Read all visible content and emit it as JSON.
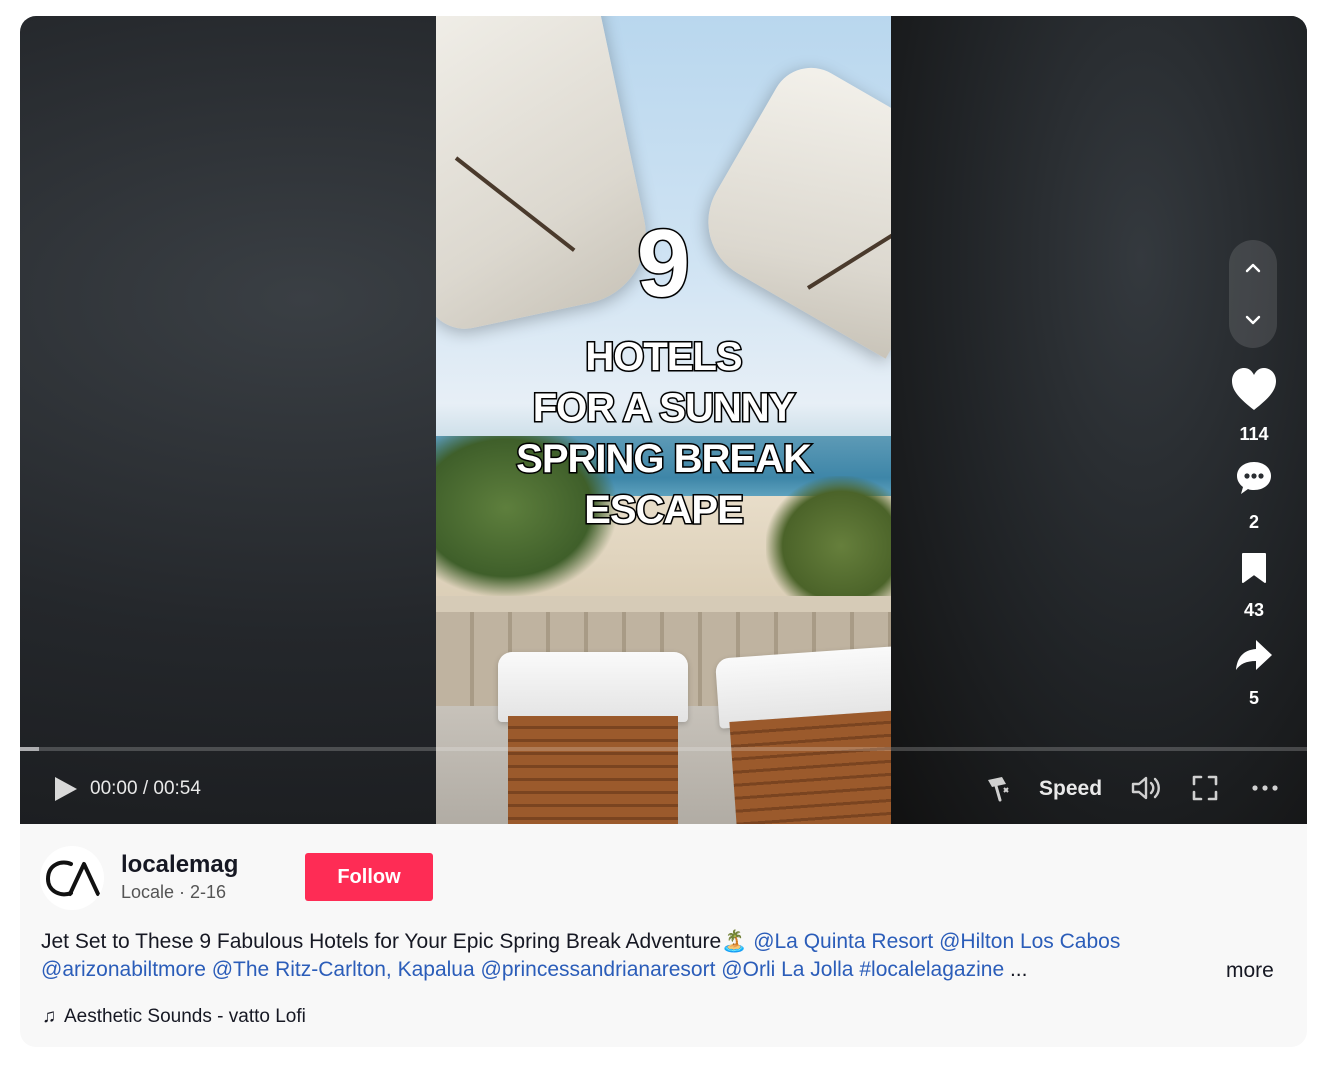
{
  "video": {
    "overlay_number": "9",
    "overlay_lines": [
      "HOTELS",
      "FOR A SUNNY",
      "SPRING BREAK",
      "ESCAPE"
    ],
    "progress_fraction": 0.015
  },
  "controls": {
    "time_display": "00:00 / 00:54",
    "speed_label": "Speed"
  },
  "actions": {
    "likes": "114",
    "comments": "2",
    "saves": "43",
    "shares": "5"
  },
  "author": {
    "username": "localemag",
    "display_name": "Locale",
    "date": "2-16",
    "subline": "Locale · 2-16",
    "avatar_text": "CA",
    "follow_label": "Follow"
  },
  "description": {
    "text": "Jet Set to These 9 Fabulous Hotels for Your Epic Spring Break Adventure",
    "emoji": "🏝️",
    "mentions_line1": [
      "@La Quinta Resort",
      "@Hilton Los Cabos"
    ],
    "mentions_line2": [
      "@arizonabiltmore",
      "@The Ritz-Carlton, Kapalua",
      "@princessandrianaresort",
      "@Orli La Jolla",
      "#localelagazine"
    ],
    "ellipsis": "...",
    "more_label": "more"
  },
  "music": {
    "label": "Aesthetic Sounds - vatto Lofi"
  },
  "colors": {
    "follow_button": "#fe2c55",
    "mention_link": "#2b5db9",
    "panel_background": "#f8f8f8"
  }
}
